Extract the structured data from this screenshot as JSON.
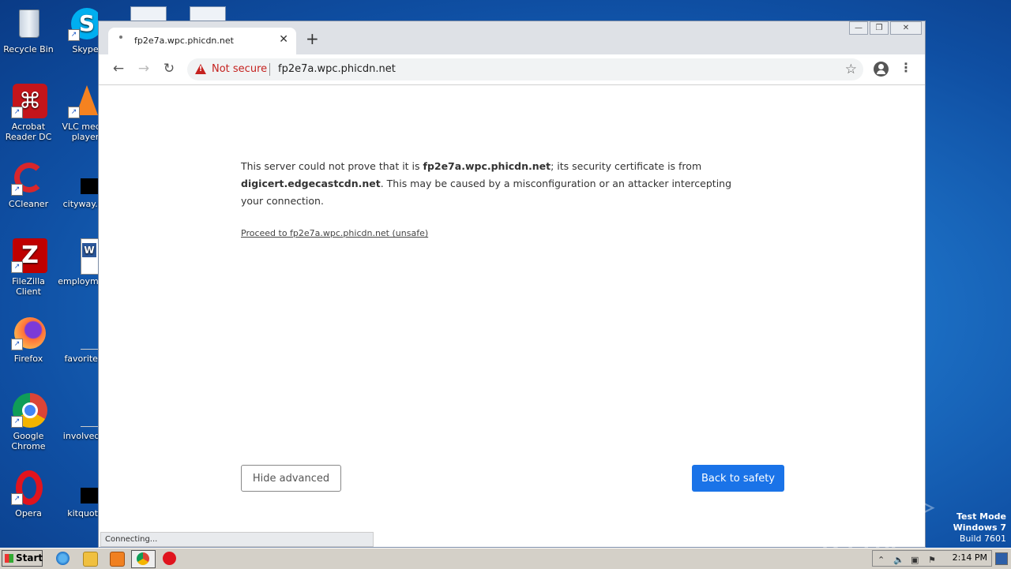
{
  "desktop": {
    "icons_col1": [
      {
        "label": "Recycle Bin"
      },
      {
        "label": "Acrobat Reader DC"
      },
      {
        "label": "CCleaner"
      },
      {
        "label": "FileZilla Client"
      },
      {
        "label": "Firefox"
      },
      {
        "label": "Google Chrome"
      },
      {
        "label": "Opera"
      }
    ],
    "icons_col2": [
      {
        "label": "Skype"
      },
      {
        "label": "VLC media player"
      },
      {
        "label": "cityway.rtf"
      },
      {
        "label": "employment"
      },
      {
        "label": "favoritefo"
      },
      {
        "label": "involvedal"
      },
      {
        "label": "kitquote"
      }
    ]
  },
  "browser": {
    "tab_title": "fp2e7a.wpc.phicdn.net",
    "new_tab_glyph": "+",
    "close_glyph": "✕",
    "security_label": "Not secure",
    "url": "fp2e7a.wpc.phicdn.net",
    "status_text": "Connecting..."
  },
  "page": {
    "para_part1": "This server could not prove that it is ",
    "para_host": "fp2e7a.wpc.phicdn.net",
    "para_part2": "; its security certificate is from ",
    "para_issuer": "digicert.edgecastcdn.net",
    "para_part3": ". This may be caused by a misconfiguration or an attacker intercepting your connection.",
    "proceed_link": "Proceed to fp2e7a.wpc.phicdn.net (unsafe)",
    "hide_advanced": "Hide advanced",
    "back_to_safety": "Back to safety"
  },
  "overlay": {
    "watermark": "ANY ▷ RUN",
    "test_mode_line1": "Test Mode",
    "test_mode_line2": "Windows 7",
    "test_mode_line3": "Build 7601"
  },
  "taskbar": {
    "start_label": "Start",
    "clock": "2:14 PM"
  },
  "colors": {
    "primary_button": "#1a73e8",
    "not_secure": "#c5221f"
  }
}
